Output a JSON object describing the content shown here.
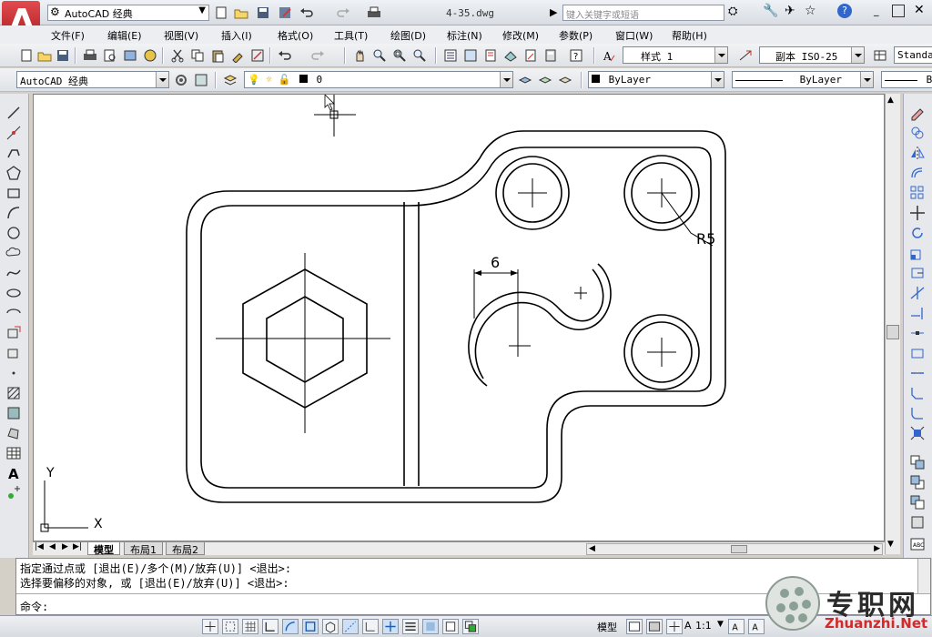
{
  "app": {
    "workspace": "AutoCAD 经典",
    "filename": "4-35.dwg",
    "search_placeholder": "键入关键字或短语"
  },
  "menu": [
    "文件(F)",
    "编辑(E)",
    "视图(V)",
    "插入(I)",
    "格式(O)",
    "工具(T)",
    "绘图(D)",
    "标注(N)",
    "修改(M)",
    "参数(P)",
    "窗口(W)",
    "帮助(H)"
  ],
  "toolbar": {
    "text_style": "样式 1",
    "dim_style": "副本 ISO-25",
    "table_style": "Standa",
    "workspace_combo": "AutoCAD 经典",
    "layer": "0",
    "color": "ByLayer",
    "linetype": "ByLayer",
    "lineweight_partial": "B"
  },
  "drawing": {
    "dim_label": "6",
    "radius_label": "R5",
    "ucs_x": "X",
    "ucs_y": "Y"
  },
  "tabs": [
    "模型",
    "布局1",
    "布局2"
  ],
  "command": {
    "line1": "指定通过点或 [退出(E)/多个(M)/放弃(U)] <退出>:",
    "line2": "选择要偏移的对象, 或 [退出(E)/放弃(U)] <退出>:",
    "prompt": "命令:"
  },
  "status": {
    "model_label": "模型",
    "scale": "1:1",
    "scale_prefix": "A"
  },
  "watermark": {
    "title": "专职网",
    "url": "Zhuanzhi.Net"
  },
  "colors": {
    "acad_red": "#c8262b",
    "canvas": "#ffffff"
  }
}
